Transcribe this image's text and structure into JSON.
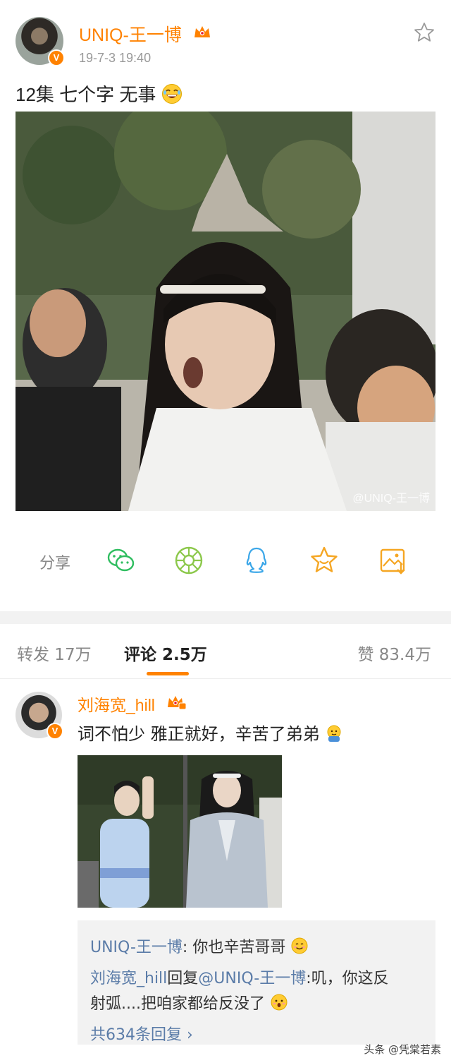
{
  "post": {
    "username": "UNIQ-王一博",
    "timestamp": "19-7-3 19:40",
    "text": "12集 七个字 无事",
    "image_watermark": "@UNIQ-王一博",
    "verified_badge": "V"
  },
  "share": {
    "label": "分享",
    "icons": [
      "wechat-icon",
      "moments-icon",
      "qq-icon",
      "favorite-star-icon",
      "save-image-icon"
    ]
  },
  "tabs": {
    "repost": "转发 17万",
    "comment": "评论 2.5万",
    "like": "赞 83.4万"
  },
  "comment": {
    "username": "刘海宽_hill",
    "text": "词不怕少 雅正就好，辛苦了弟弟",
    "verified_badge": "V",
    "replies": [
      {
        "name": "UNIQ-王一博",
        "text": ": 你也辛苦哥哥"
      },
      {
        "name": "刘海宽_hill",
        "mid": "回复",
        "mention": "@UNIQ-王一博",
        "text": ":叽，你这反"
      },
      {
        "text": "射弧....把咱家都给反没了"
      }
    ],
    "more_replies": "共634条回复 ›"
  },
  "source_mark": "头条 @凭棠若素",
  "colors": {
    "accent_orange": "#ff8200",
    "link_blue": "#5b7ca8",
    "wechat_green": "#2ebd5f",
    "moments_green": "#8cc84b",
    "qq_blue": "#3aa6e8",
    "favorite_orange": "#f5a623"
  }
}
